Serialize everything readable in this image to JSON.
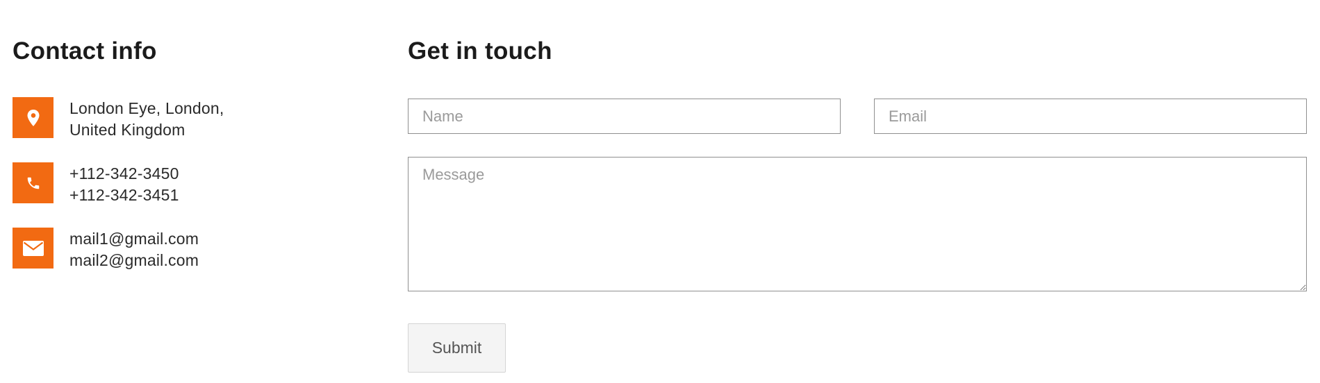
{
  "contact": {
    "heading": "Contact info",
    "items": [
      {
        "icon": "map-pin-icon",
        "lines": [
          "London Eye, London,",
          "United Kingdom"
        ]
      },
      {
        "icon": "phone-icon",
        "lines": [
          "+112-342-3450",
          "+112-342-3451"
        ]
      },
      {
        "icon": "envelope-icon",
        "lines": [
          "mail1@gmail.com",
          "mail2@gmail.com"
        ]
      }
    ]
  },
  "form": {
    "heading": "Get in touch",
    "name_placeholder": "Name",
    "email_placeholder": "Email",
    "message_placeholder": "Message",
    "submit_label": "Submit"
  },
  "colors": {
    "accent": "#f26a12"
  }
}
